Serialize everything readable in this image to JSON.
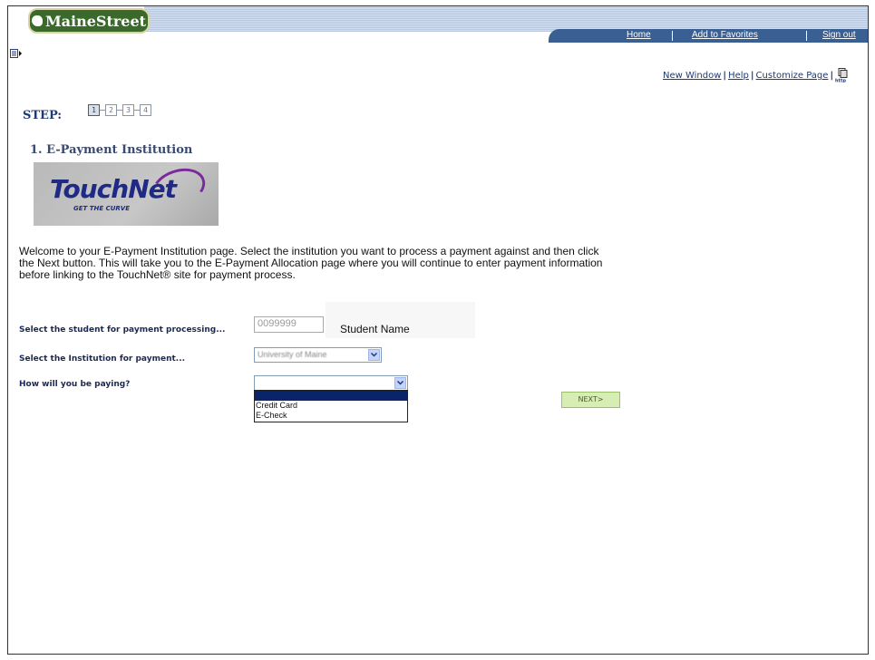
{
  "header": {
    "logo_text": "MaineStreet",
    "nav": {
      "home": "Home",
      "favorites": "Add to Favorites",
      "signout": "Sign out"
    }
  },
  "utility": {
    "new_window": "New Window",
    "help": "Help",
    "customize": "Customize Page"
  },
  "steps": {
    "label": "STEP:",
    "items": [
      "1",
      "2",
      "3",
      "4"
    ],
    "current": 1
  },
  "section": {
    "title": "1. E-Payment Institution"
  },
  "touchnet": {
    "logo_text": "TouchNet",
    "tagline": "GET THE CURVE"
  },
  "intro": "Welcome to your E-Payment Institution page. Select the institution you want to process a payment against and then click the Next button. This will take you to the E-Payment Allocation page where you will continue to enter payment information before linking to the TouchNet® site for payment process.",
  "form": {
    "student_label": "Select the student for payment processing...",
    "student_id": "0099999",
    "student_name": "Student Name",
    "institution_label": "Select the Institution for payment...",
    "institution_value": "University of Maine",
    "paying_label": "How will you be paying?",
    "paying_options": [
      "",
      "Credit Card",
      "E-Check"
    ],
    "next_label": "NEXT>"
  }
}
